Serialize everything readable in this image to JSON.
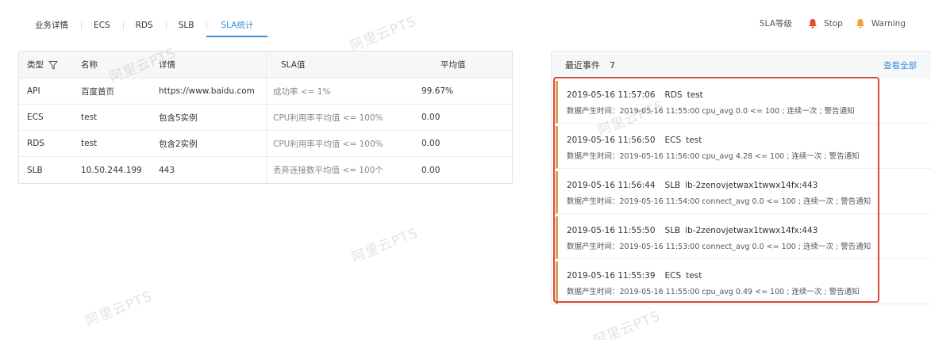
{
  "tabs": [
    "业务详情",
    "ECS",
    "RDS",
    "SLB",
    "SLA统计"
  ],
  "legend": {
    "label": "SLA等级",
    "stop": "Stop",
    "warning": "Warning",
    "stop_color": "#e04a2e",
    "warning_color": "#e8a33a"
  },
  "table": {
    "headers": [
      "类型",
      "名称",
      "详情",
      "SLA值",
      "平均值"
    ],
    "rows": [
      [
        "API",
        "百度首页",
        "https://www.baidu.com",
        "成功率 <= 1%",
        "99.67%"
      ],
      [
        "ECS",
        "test",
        "包含5实例",
        "CPU利用率平均值 <= 100%",
        "0.00"
      ],
      [
        "RDS",
        "test",
        "包含2实例",
        "CPU利用率平均值 <= 100%",
        "0.00"
      ],
      [
        "SLB",
        "10.50.244.199",
        "443",
        "丢弃连接数平均值 <= 100个",
        "0.00"
      ]
    ]
  },
  "events": {
    "title": "最近事件",
    "count": "7",
    "view_all": "查看全部",
    "items": [
      {
        "time": "2019-05-16 11:57:06",
        "type": "RDS",
        "name": "test",
        "detail": "数据产生时间：2019-05-16 11:55:00 cpu_avg 0.0 <= 100 ; 连续一次 ; 警告通知"
      },
      {
        "time": "2019-05-16 11:56:50",
        "type": "ECS",
        "name": "test",
        "detail": "数据产生时间：2019-05-16 11:56:00 cpu_avg 4.28 <= 100 ; 连续一次 ; 警告通知"
      },
      {
        "time": "2019-05-16 11:56:44",
        "type": "SLB",
        "name": "lb-2zenovjetwax1twwx14fx:443",
        "detail": "数据产生时间：2019-05-16 11:54:00 connect_avg 0.0 <= 100 ; 连续一次 ; 警告通知"
      },
      {
        "time": "2019-05-16 11:55:50",
        "type": "SLB",
        "name": "lb-2zenovjetwax1twwx14fx:443",
        "detail": "数据产生时间：2019-05-16 11:53:00 connect_avg 0.0 <= 100 ; 连续一次 ; 警告通知"
      },
      {
        "time": "2019-05-16 11:55:39",
        "type": "ECS",
        "name": "test",
        "detail": "数据产生时间：2019-05-16 11:55:00 cpu_avg 0.49 <= 100 ; 连续一次 ; 警告通知"
      }
    ]
  },
  "watermark": "阿里云PTS"
}
